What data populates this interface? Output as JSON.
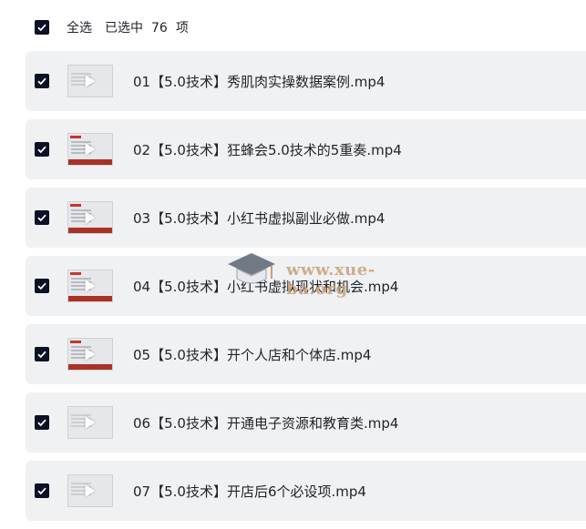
{
  "header": {
    "select_all_label": "全选",
    "selected_prefix": "已选中",
    "selected_count": "76",
    "selected_suffix": "项"
  },
  "items": [
    {
      "title": "01【5.0技术】秀肌肉实操数据案例.mp4",
      "checked": true
    },
    {
      "title": "02【5.0技术】狂蜂会5.0技术的5重奏.mp4",
      "checked": true
    },
    {
      "title": "03【5.0技术】小红书虚拟副业必做.mp4",
      "checked": true
    },
    {
      "title": "04【5.0技术】小红书虚拟现状和机会.mp4",
      "checked": true
    },
    {
      "title": "05【5.0技术】开个人店和个体店.mp4",
      "checked": true
    },
    {
      "title": "06【5.0技术】开通电子资源和教育类.mp4",
      "checked": true
    },
    {
      "title": "07【5.0技术】开店后6个必设项.mp4",
      "checked": true
    }
  ],
  "watermark": {
    "text": "www.xue-ba.org"
  },
  "colors": {
    "checkbox": "#0d1126",
    "row_bg": "#f0f1f3",
    "thumb_accent": "#a93226"
  }
}
